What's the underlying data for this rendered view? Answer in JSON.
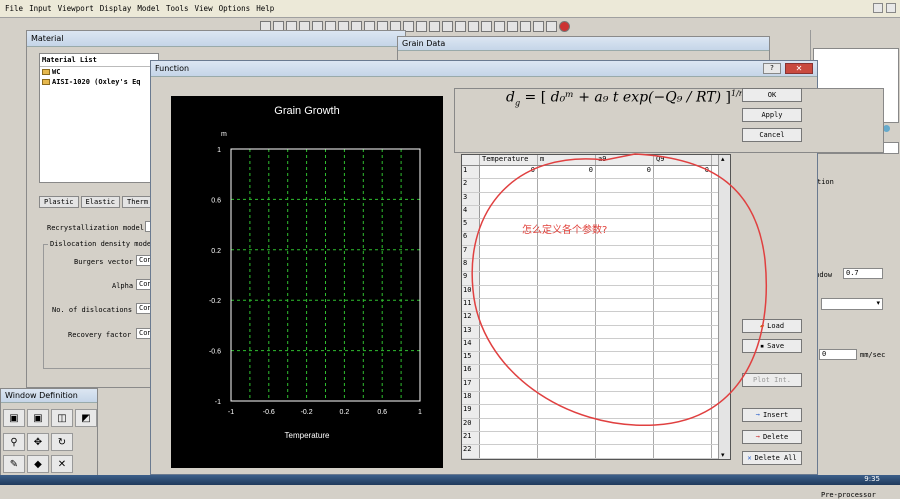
{
  "menu": [
    "File",
    "Input",
    "Viewport",
    "Display",
    "Model",
    "Tools",
    "View",
    "Options",
    "Help"
  ],
  "material_window": {
    "title": "Material",
    "list_header": "Material List",
    "items": [
      "WC",
      "AISI-1020 (Oxley's Eq"
    ],
    "tabs": [
      "Plastic",
      "Elastic",
      "Therm"
    ],
    "recryst_label": "Recrystallization model",
    "disloc_group": "Dislocation density mode",
    "fields": [
      {
        "label": "Burgers vector",
        "value": "Con"
      },
      {
        "label": "Alpha",
        "value": "Con"
      },
      {
        "label": "No. of dislocations",
        "value": "Con"
      },
      {
        "label": "Recovery factor",
        "value": "Con"
      }
    ]
  },
  "grain_window": {
    "title": "Grain Data"
  },
  "function_window": {
    "title": "Function",
    "close": "✕",
    "help": "?"
  },
  "chart_data": {
    "type": "line",
    "title": "Grain Growth",
    "xlabel": "Temperature",
    "ylabel": "m",
    "x_ticks": [
      "-1",
      "-0.6",
      "-0.2",
      "0.2",
      "0.6",
      "1"
    ],
    "y_ticks": [
      "1",
      "0.6",
      "0.2",
      "-0.2",
      "-0.6",
      "-1"
    ],
    "xlim": [
      -1,
      1
    ],
    "ylim": [
      -1,
      1
    ],
    "grid": true,
    "series": []
  },
  "formula": {
    "lhs": "d",
    "lhs_sub": "g",
    "rhs": "d₀ᵐ + a₉ t exp(−Q₉ / RT)",
    "exponent": "1/m"
  },
  "table": {
    "headers": [
      "Temperature",
      "m",
      "a9",
      "Q9"
    ],
    "rows": [
      [
        "1",
        "0",
        "0",
        "0",
        "0"
      ],
      [
        "2",
        "",
        "",
        "",
        ""
      ],
      [
        "3",
        "",
        "",
        "",
        ""
      ],
      [
        "4",
        "",
        "",
        "",
        ""
      ],
      [
        "5",
        "",
        "",
        "",
        ""
      ],
      [
        "6",
        "",
        "",
        "",
        ""
      ],
      [
        "7",
        "",
        "",
        "",
        ""
      ],
      [
        "8",
        "",
        "",
        "",
        ""
      ],
      [
        "9",
        "",
        "",
        "",
        ""
      ],
      [
        "10",
        "",
        "",
        "",
        ""
      ],
      [
        "11",
        "",
        "",
        "",
        ""
      ],
      [
        "12",
        "",
        "",
        "",
        ""
      ],
      [
        "13",
        "",
        "",
        "",
        ""
      ],
      [
        "14",
        "",
        "",
        "",
        ""
      ],
      [
        "15",
        "",
        "",
        "",
        ""
      ],
      [
        "16",
        "",
        "",
        "",
        ""
      ],
      [
        "17",
        "",
        "",
        "",
        ""
      ],
      [
        "18",
        "",
        "",
        "",
        ""
      ],
      [
        "19",
        "",
        "",
        "",
        ""
      ],
      [
        "20",
        "",
        "",
        "",
        ""
      ],
      [
        "21",
        "",
        "",
        "",
        ""
      ],
      [
        "22",
        "",
        "",
        "",
        ""
      ]
    ]
  },
  "buttons": {
    "ok": "OK",
    "apply": "Apply",
    "cancel": "Cancel",
    "load": "Load",
    "save": "Save",
    "plot_int": "Plot Int.",
    "insert": "Insert",
    "delete": "Delete",
    "delete_all": "Delete All"
  },
  "annotation": "怎么定义各个参数?",
  "window_def": {
    "title": "Window Definition"
  },
  "right_panel": {
    "window_label": "indow",
    "window_value": "0.7",
    "speed_value": "0",
    "speed_unit": "mm/sec",
    "mode": "Pre-processor",
    "time": "9:35",
    "tion": "tion"
  }
}
